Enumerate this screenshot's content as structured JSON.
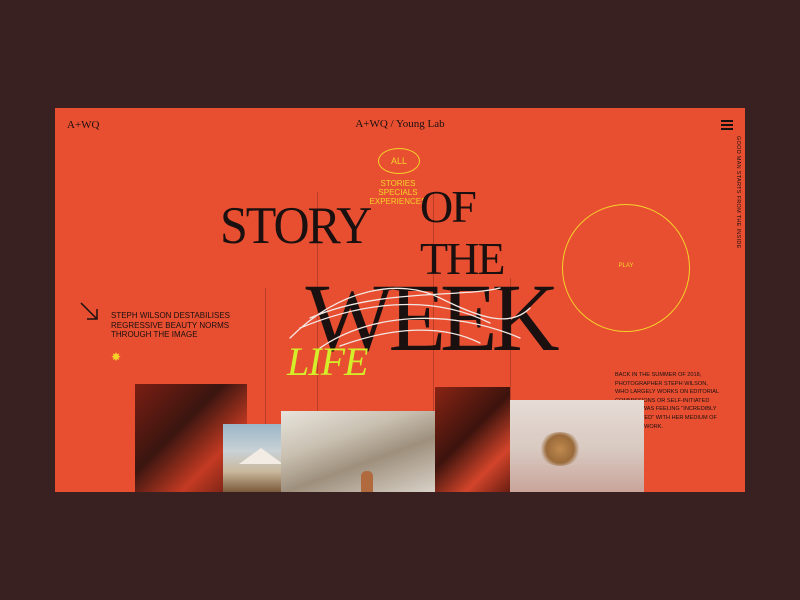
{
  "header": {
    "logo": "A+WQ",
    "title": "A+WQ / Young Lab",
    "menu_icon": "hamburger-menu-icon",
    "side_text": "GOOD MAN STARTS FROM THE INSIDE"
  },
  "filters": {
    "all": "ALL",
    "items": [
      "STORIES",
      "SPECIALS",
      "EXPERIENCES"
    ]
  },
  "headline": {
    "line1": "STORY",
    "line2a": "OF",
    "line2b": "THE",
    "line3": "WEEK",
    "accent": "LIFE"
  },
  "play": {
    "label": "PLAY"
  },
  "author": {
    "arrow_icon": "arrow-down-right-icon",
    "text": "STEPH WILSON DESTABILISES REGRESSIVE BEAUTY NORMS THROUGH THE IMAGE",
    "burst_icon": "sunburst-icon"
  },
  "bio": "BACK IN THE SUMMER OF 2018, PHOTOGRAPHER STEPH WILSON, WHO LARGELY WORKS ON EDITORIAL COMMISSIONS OR SELF-INITIATED SHOOTS, WAS FEELING \"INCREDIBLY FRUSTRATED\" WITH HER MEDIUM OF CREATIVE WORK.",
  "colors": {
    "background": "#3a2121",
    "page": "#e84f31",
    "accent_yellow": "#f5d22a",
    "accent_lime": "#d4ef2a",
    "ink": "#1a1010"
  }
}
